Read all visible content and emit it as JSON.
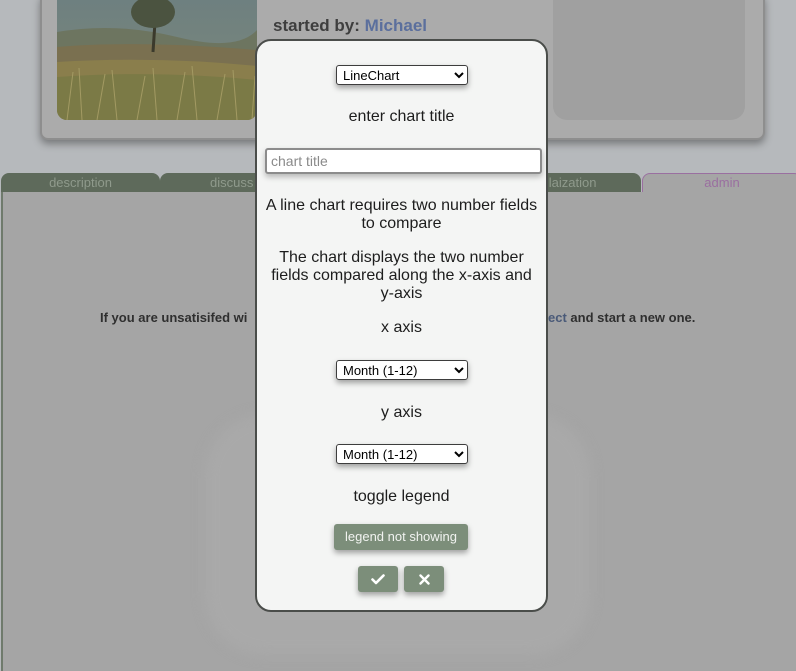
{
  "background": {
    "started_by_label": "started by:",
    "started_by_user": "Michael",
    "tabs": [
      "description",
      "discuss",
      "sulaization",
      "admin"
    ],
    "notice_left": "If you are unsatisifed wi",
    "notice_right_cut": "ect",
    "notice_right_rest": " and start a new one."
  },
  "modal": {
    "chart_type_options": [
      "LineChart"
    ],
    "chart_type_selected": "LineChart",
    "title_prompt": "enter chart title",
    "title_placeholder": "chart title",
    "title_value": "",
    "description_1": "A line chart requires two number fields to compare",
    "description_2": "The chart displays the two number fields compared along the x-axis and y-axis",
    "x_axis_label": "x axis",
    "x_axis_selected": "Month (1-12)",
    "y_axis_label": "y axis",
    "y_axis_selected": "Month (1-12)",
    "legend_label": "toggle legend",
    "legend_button": "legend not showing",
    "confirm_icon": "check-icon",
    "cancel_icon": "close-icon"
  },
  "colors": {
    "button_green": "#7c8e7a",
    "admin_tab_accent": "#9a6fa0",
    "user_link": "#5b6f9d"
  }
}
